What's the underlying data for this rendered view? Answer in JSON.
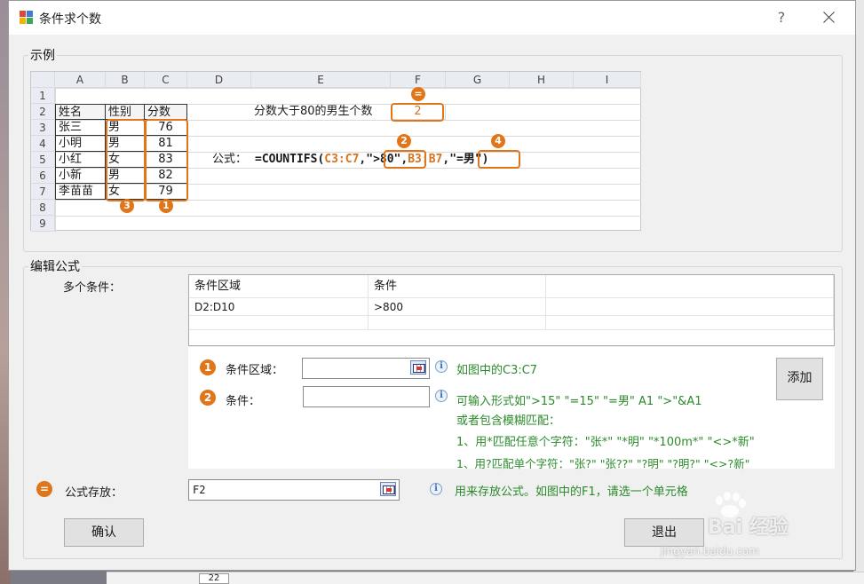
{
  "window": {
    "title": "条件求个数",
    "help_glyph": "?"
  },
  "example": {
    "legend": "示例",
    "columns": [
      "A",
      "B",
      "C",
      "D",
      "E",
      "F",
      "G",
      "H",
      "I"
    ],
    "rows": [
      "1",
      "2",
      "3",
      "4",
      "5",
      "6",
      "7",
      "8",
      "9"
    ],
    "table": {
      "headers": [
        "姓名",
        "性别",
        "分数"
      ],
      "records": [
        [
          "张三",
          "男",
          "76"
        ],
        [
          "小明",
          "男",
          "81"
        ],
        [
          "小红",
          "女",
          "83"
        ],
        [
          "小新",
          "男",
          "82"
        ],
        [
          "李苗苗",
          "女",
          "79"
        ]
      ]
    },
    "question": "分数大于80的男生个数",
    "result": "2",
    "formula_label": "公式：",
    "formula_parts": {
      "p1": "=COUNTIFS(",
      "p2": "C3:C7",
      "p3": ",",
      "p4": "\">80\"",
      "p5": ",",
      "p6": "B3:B7",
      "p7": ",",
      "p8": "\"=男\"",
      "p9": ")"
    },
    "badges": {
      "equals": "=",
      "one": "1",
      "two": "2",
      "three": "3",
      "four": "4"
    }
  },
  "edit": {
    "legend": "编辑公式",
    "multi_label": "多个条件：",
    "grid": {
      "headers": [
        "条件区域",
        "条件"
      ],
      "rows": [
        [
          "D2:D10",
          ">800"
        ]
      ]
    },
    "range_label": "条件区域：",
    "range_value": "",
    "range_hint": "如图中的C3:C7",
    "cond_label": "条件：",
    "cond_value": "",
    "cond_hints": [
      "可输入形式如\">15\"  \"=15\"  \"=男\"  A1  \">\"&A1",
      "或者包含模糊匹配：",
      "1、用*匹配任意个字符：\"张*\"  \"*明\"  \"*100m*\"  \"<>*新\"",
      "1、用?匹配单个字符：\"张?\"  \"张??\"  \"?明\"  \"?明?\"  \"<>?新\""
    ],
    "add_button": "添加",
    "store_label": "公式存放：",
    "store_value": "F2",
    "store_hint": "用来存放公式。如图中的F1，请选一个单元格",
    "ok_button": "确认",
    "exit_button": "退出"
  },
  "backdrop": {
    "cell_label": "22"
  },
  "watermark": {
    "text": "Bai 经验",
    "sub": "jingyan.baidu.com"
  },
  "colors": {
    "accent": "#e0751a",
    "hint": "#2b8a2b"
  }
}
